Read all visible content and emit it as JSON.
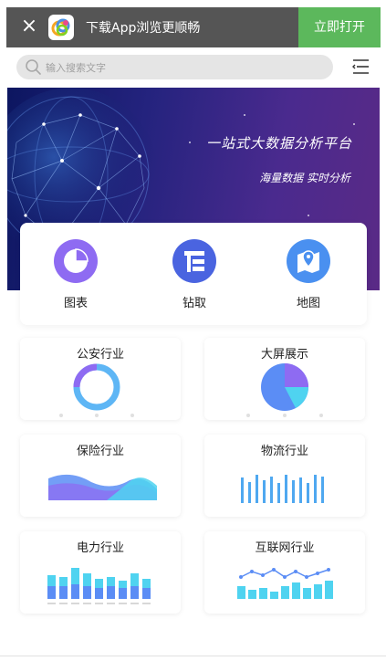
{
  "topbar": {
    "close_glyph": "×",
    "title": "下载App浏览更顺畅",
    "open_button": "立即打开"
  },
  "search": {
    "placeholder": "输入搜索文字"
  },
  "banner": {
    "headline": "一站式大数据分析平台",
    "subline": "海量数据 实时分析"
  },
  "features": [
    {
      "label": "图表",
      "icon": "pie-chart-icon",
      "color": "#8e6bf2"
    },
    {
      "label": "钻取",
      "icon": "drill-icon",
      "color": "#4a64e0"
    },
    {
      "label": "地图",
      "icon": "map-pin-icon",
      "color": "#4a90f0"
    }
  ],
  "industries": [
    {
      "title": "公安行业",
      "preview": "ring-chart"
    },
    {
      "title": "大屏展示",
      "preview": "pie-chart"
    },
    {
      "title": "保险行业",
      "preview": "area-chart"
    },
    {
      "title": "物流行业",
      "preview": "bar-chart"
    },
    {
      "title": "电力行业",
      "preview": "stacked-bar-chart"
    },
    {
      "title": "互联网行业",
      "preview": "bar-line-chart"
    }
  ],
  "colors": {
    "open_button": "#5cb85c",
    "topbar": "#555555",
    "accent_blue": "#4a90f0",
    "accent_purple": "#8e6bf2"
  }
}
